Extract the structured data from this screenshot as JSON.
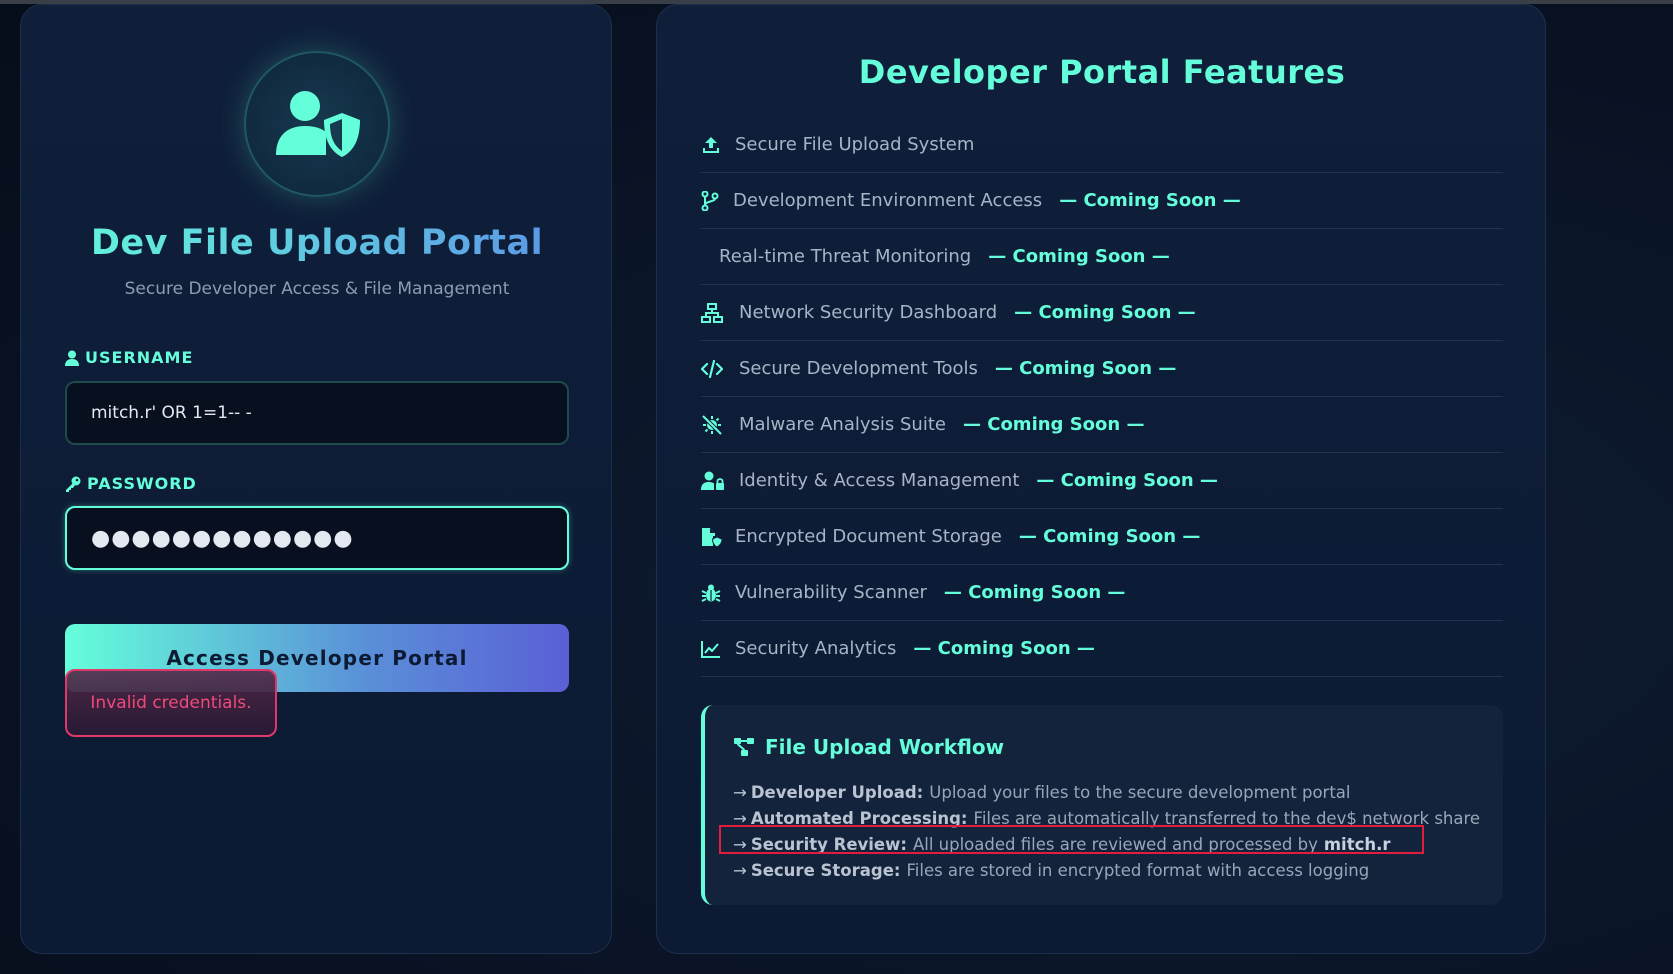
{
  "login": {
    "title": "Dev File Upload Portal",
    "subtitle": "Secure Developer Access & File Management",
    "username_label": "USERNAME",
    "username_value": "mitch.r' OR 1=1-- -",
    "password_label": "PASSWORD",
    "password_value": "●●●●●●●●●●●●●",
    "submit_label": "Access Developer Portal",
    "error_text": "Invalid credentials."
  },
  "features": {
    "title": "Developer Portal Features",
    "items": [
      {
        "label": "Secure File Upload System",
        "icon": "upload-icon",
        "status": ""
      },
      {
        "label": "Development Environment Access",
        "icon": "code-branch-icon",
        "status": "— Coming Soon —"
      },
      {
        "label": "Real-time Threat Monitoring",
        "icon": "",
        "status": "— Coming Soon —"
      },
      {
        "label": "Network Security Dashboard",
        "icon": "network-icon",
        "status": "— Coming Soon —"
      },
      {
        "label": "Secure Development Tools",
        "icon": "code-icon",
        "status": "— Coming Soon —"
      },
      {
        "label": "Malware Analysis Suite",
        "icon": "virus-slash-icon",
        "status": "— Coming Soon —"
      },
      {
        "label": "Identity & Access Management",
        "icon": "user-lock-icon",
        "status": "— Coming Soon —"
      },
      {
        "label": "Encrypted Document Storage",
        "icon": "file-shield-icon",
        "status": "— Coming Soon —"
      },
      {
        "label": "Vulnerability Scanner",
        "icon": "bug-icon",
        "status": "— Coming Soon —"
      },
      {
        "label": "Security Analytics",
        "icon": "chart-line-icon",
        "status": "— Coming Soon —"
      }
    ]
  },
  "workflow": {
    "title": "File Upload Workflow",
    "steps": [
      {
        "label": "Developer Upload:",
        "text": "Upload your files to the secure development portal",
        "strong": ""
      },
      {
        "label": "Automated Processing:",
        "text": "Files are automatically transferred to the dev$ network share",
        "strong": ""
      },
      {
        "label": "Security Review:",
        "text": "All uploaded files are reviewed and processed by",
        "strong": "mitch.r"
      },
      {
        "label": "Secure Storage:",
        "text": "Files are stored in encrypted format with access logging",
        "strong": ""
      }
    ]
  },
  "colors": {
    "accent": "#64ffda",
    "error": "#f04a7a",
    "highlight": "#e31b3c",
    "background": "#0a1426"
  }
}
